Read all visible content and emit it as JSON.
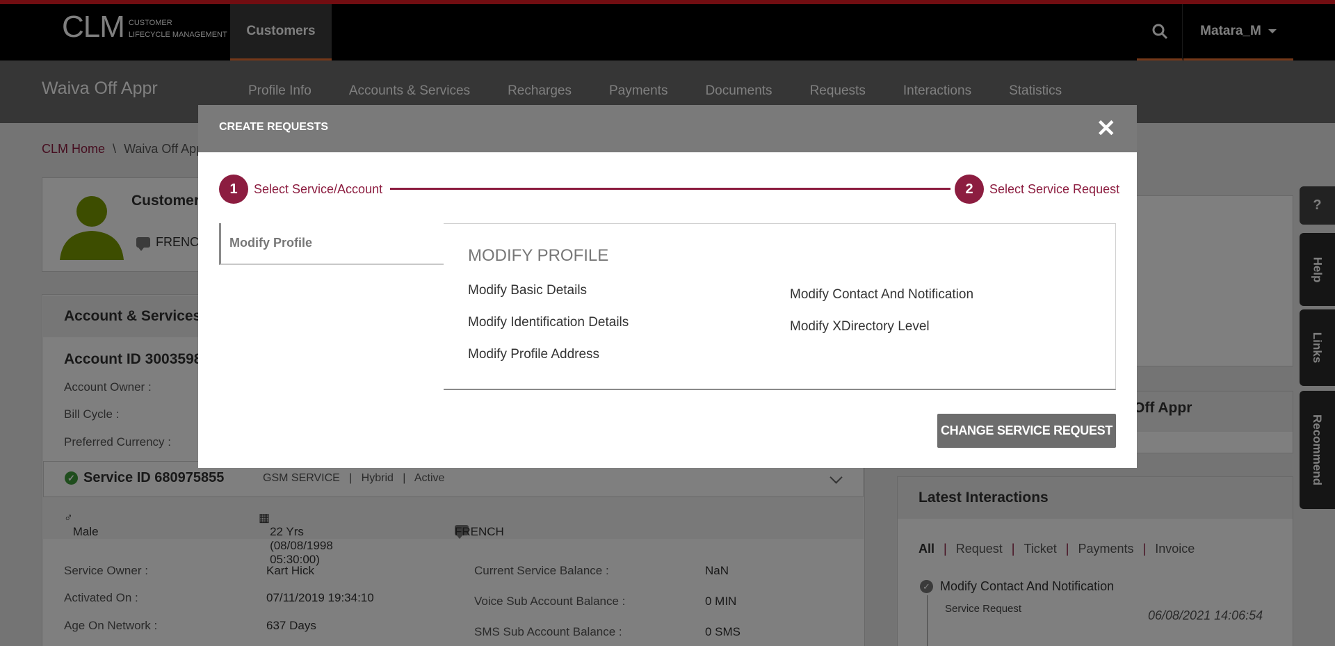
{
  "header": {
    "logo_big": "CLM",
    "logo_small_line1": "CUSTOMER",
    "logo_small_line2": "LIFECYCLE MANAGEMENT",
    "active_tab": "Customers",
    "user": "Matara_M"
  },
  "subheader": {
    "title": "Waiva Off Appr",
    "nav": [
      "Profile Info",
      "Accounts & Services",
      "Recharges",
      "Payments",
      "Documents",
      "Requests",
      "Interactions",
      "Statistics"
    ]
  },
  "breadcrumb": {
    "home": "CLM Home",
    "separator": "\\",
    "current": "Waiva Off Appr"
  },
  "customer": {
    "name": "Customer",
    "language": "FRENCH"
  },
  "accounts": {
    "header": "Account & Services",
    "account_id": "Account ID 3003598",
    "labels": [
      "Account Owner :",
      "Bill Cycle :",
      "Preferred Currency :"
    ]
  },
  "service": {
    "id": "Service ID 680975855",
    "meta": "GSM SERVICE   |   Hybrid   |   Active",
    "gender": "Male",
    "age": "22 Yrs (08/08/1998 05:30:00)",
    "language": "FRENCH",
    "left_labels": [
      "Service Owner :",
      "Activated On :",
      "Age On Network :"
    ],
    "left_values": [
      "Kart Hick",
      "07/11/2019 19:34:10",
      "637 Days"
    ],
    "right_labels": [
      "Current Service Balance :",
      "Voice Sub Account Balance :",
      "SMS Sub Account Balance :"
    ],
    "right_values": [
      "NaN",
      "0 MIN",
      "0 SMS"
    ]
  },
  "right_panel": {
    "off_appr": "Off Appr",
    "latest_title": "Latest Interactions",
    "filters": [
      "All",
      "Request",
      "Ticket",
      "Payments",
      "Invoice"
    ],
    "item_title": "Modify Contact And Notification",
    "item_sub": "Service Request",
    "item_date": "06/08/2021 14:06:54"
  },
  "side_tabs": [
    "?",
    "Help",
    "Links",
    "Recommend"
  ],
  "modal": {
    "title": "CREATE REQUESTS",
    "close": "✕",
    "step1_num": "1",
    "step1_label": "Select Service/Account",
    "step2_num": "2",
    "step2_label": "Select Service Request",
    "side_menu": "Modify Profile",
    "section_title": "MODIFY PROFILE",
    "col1": [
      "Modify Basic Details",
      "Modify Identification Details",
      "Modify Profile Address"
    ],
    "col2": [
      "Modify Contact And Notification",
      "Modify XDirectory Level"
    ],
    "button": "CHANGE SERVICE REQUEST"
  },
  "colors": {
    "accent": "#8c1d40",
    "topline": "#e31b23",
    "tab_underline": "#e97132"
  }
}
